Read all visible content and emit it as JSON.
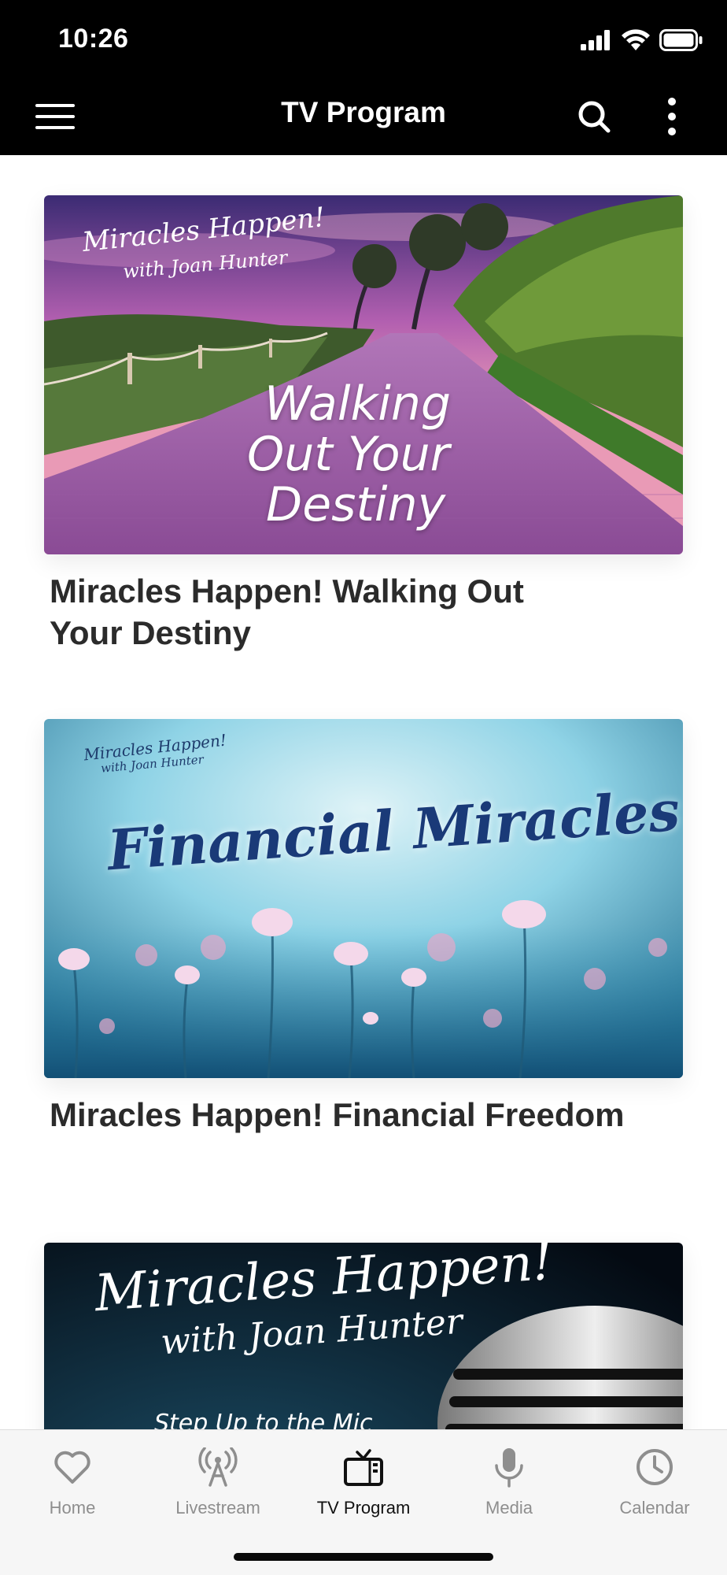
{
  "status_bar": {
    "time": "10:26"
  },
  "header": {
    "title": "TV Program",
    "menu_icon": "hamburger-menu-icon",
    "search_icon": "search-icon",
    "more_icon": "more-vertical-icon"
  },
  "programs": [
    {
      "title": "Miracles Happen! Walking Out Your Destiny",
      "thumb_brand_line1": "Miracles Happen!",
      "thumb_brand_line2": "with Joan Hunter",
      "thumb_headline_1": "Walking",
      "thumb_headline_2": "Out Your",
      "thumb_headline_3": "Destiny"
    },
    {
      "title": "Miracles Happen! Financial Freedom",
      "thumb_brand_line1": "Miracles Happen!",
      "thumb_brand_line2": "with Joan Hunter",
      "thumb_headline": "Financial Miracles"
    },
    {
      "title": "",
      "thumb_brand_line1": "Miracles Happen!",
      "thumb_brand_line2": "with Joan Hunter",
      "thumb_subtitle": "Step Up to the Mic"
    }
  ],
  "tabs": [
    {
      "label": "Home",
      "icon": "heart-icon",
      "active": false
    },
    {
      "label": "Livestream",
      "icon": "broadcast-tower-icon",
      "active": false
    },
    {
      "label": "TV Program",
      "icon": "tv-icon",
      "active": true
    },
    {
      "label": "Media",
      "icon": "microphone-icon",
      "active": false
    },
    {
      "label": "Calendar",
      "icon": "clock-icon",
      "active": false
    }
  ],
  "colors": {
    "header_bg": "#000000",
    "active_tab": "#111111",
    "inactive_tab": "#8e8e8e",
    "title_text": "#2b2b2b"
  }
}
